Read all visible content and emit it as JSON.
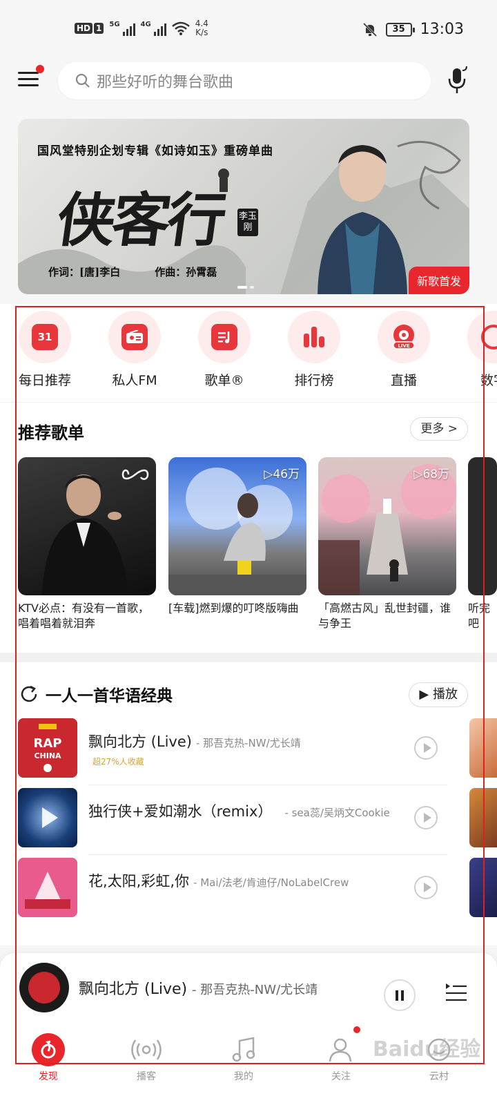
{
  "status_bar": {
    "hd": "HD",
    "sim": "1",
    "net1": "5G",
    "net2": "4G",
    "speed_value": "4.4",
    "speed_unit": "K/s",
    "battery": "35",
    "time": "13:03"
  },
  "search": {
    "placeholder": "那些好听的舞台歌曲"
  },
  "banner": {
    "subtitle": "国风堂特别企划专辑《如诗如玉》重磅单曲",
    "title": "侠客行",
    "singer": "李玉刚",
    "lyricist": "作词：[唐]李白",
    "composer": "作曲：孙霄磊",
    "tag": "新歌首发"
  },
  "shortcuts": [
    {
      "label": "每日推荐",
      "icon": "calendar-icon",
      "badge": "31"
    },
    {
      "label": "私人FM",
      "icon": "radio-icon"
    },
    {
      "label": "歌单®",
      "icon": "playlist-icon"
    },
    {
      "label": "排行榜",
      "icon": "chart-icon"
    },
    {
      "label": "直播",
      "icon": "live-icon"
    },
    {
      "label": "数字",
      "icon": "digital-icon"
    }
  ],
  "recommend": {
    "title": "推荐歌单",
    "more": "更多 >",
    "playlists": [
      {
        "name": "KTV必点：有没有一首歌，唱着唱着就泪奔",
        "count": "",
        "icon": "infinity-icon"
      },
      {
        "name": "[车载]燃到爆的叮咚版嗨曲",
        "count": "▷46万"
      },
      {
        "name": "「高燃古风」乱世封疆，谁与争王",
        "count": "▷68万"
      },
      {
        "name": "听完吧",
        "count": ""
      }
    ]
  },
  "daily": {
    "title": "一人一首华语经典",
    "play_all": "▶ 播放",
    "songs": [
      {
        "title": "飘向北方 (Live)",
        "artist": "- 那吾克热-NW/尤长靖",
        "tag": "超27%人收藏"
      },
      {
        "title": "独行侠+爱如潮水（remix）",
        "artist": "- sea蕊/吴炳文Cookie",
        "tag": ""
      },
      {
        "title": "花,太阳,彩虹,你",
        "artist": "- Mai/法老/肯迪仔/NoLabelCrew",
        "tag": ""
      }
    ]
  },
  "player": {
    "title": "飘向北方 (Live)",
    "artist": "- 那吾克热-NW/尤长靖"
  },
  "nav": [
    {
      "label": "发现",
      "icon": "discover-icon",
      "active": true
    },
    {
      "label": "播客",
      "icon": "podcast-icon"
    },
    {
      "label": "我的",
      "icon": "music-note-icon"
    },
    {
      "label": "关注",
      "icon": "follow-icon"
    },
    {
      "label": "云村",
      "icon": "cloud-village-icon"
    }
  ],
  "watermark": "Baidu经验",
  "colors": {
    "accent": "#e8262c",
    "background": "#f6f6f7"
  }
}
